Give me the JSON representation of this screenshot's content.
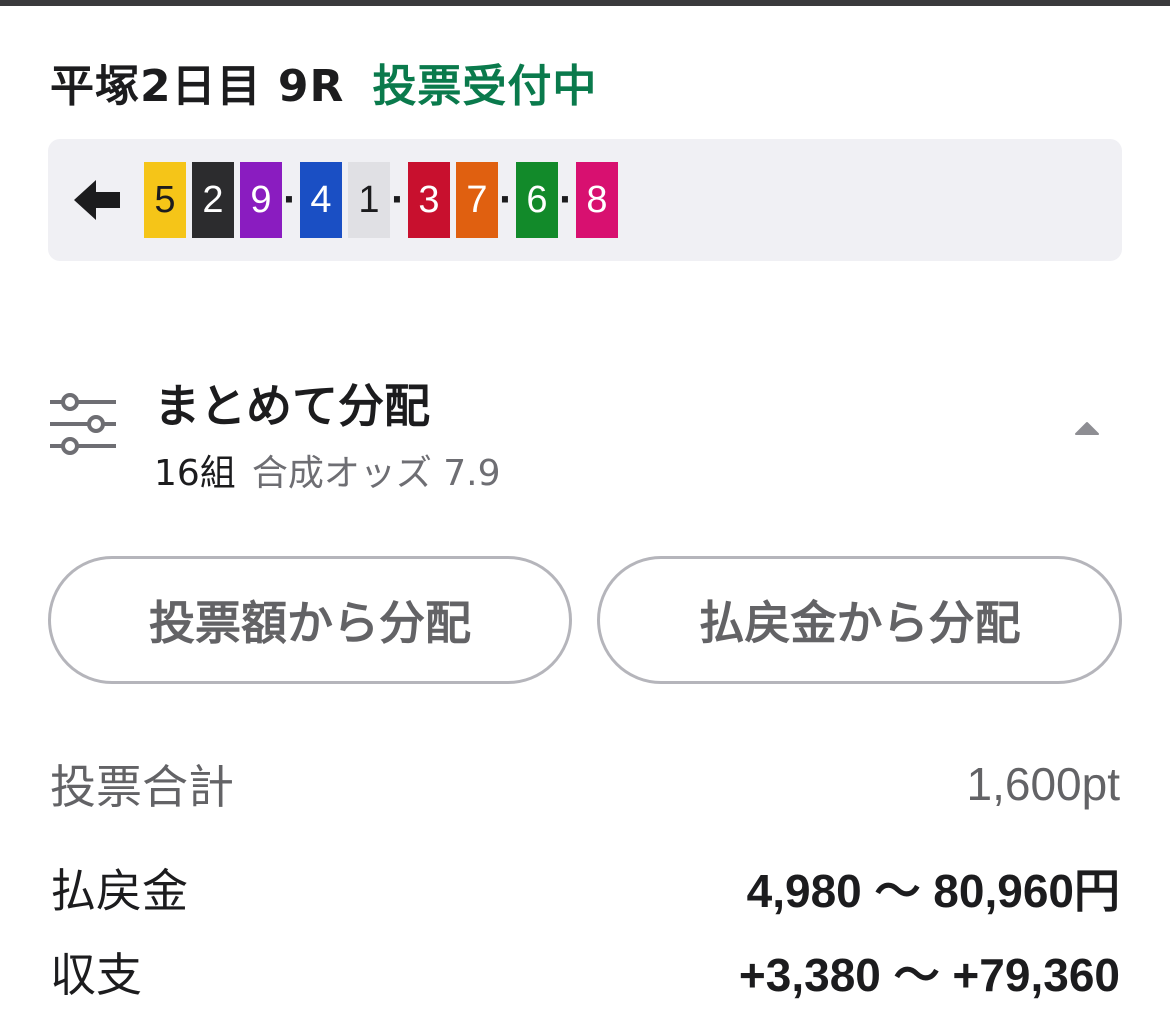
{
  "header": {
    "race_title": "平塚2日目 9R",
    "status": "投票受付中",
    "status_color": "#0a7a4c"
  },
  "line": {
    "direction_icon": "arrow-left-icon",
    "groups": [
      [
        {
          "number": "5",
          "bg": "#f5c518",
          "fg": "#1c1c1e"
        },
        {
          "number": "2",
          "bg": "#2c2c2e",
          "fg": "#ffffff"
        },
        {
          "number": "9",
          "bg": "#8a1cc0",
          "fg": "#ffffff"
        }
      ],
      [
        {
          "number": "4",
          "bg": "#1a4fc4",
          "fg": "#ffffff"
        },
        {
          "number": "1",
          "bg": "#e0e0e4",
          "fg": "#1c1c1e"
        }
      ],
      [
        {
          "number": "3",
          "bg": "#c8102e",
          "fg": "#ffffff"
        },
        {
          "number": "7",
          "bg": "#e06010",
          "fg": "#ffffff"
        }
      ],
      [
        {
          "number": "6",
          "bg": "#128a2a",
          "fg": "#ffffff"
        }
      ],
      [
        {
          "number": "8",
          "bg": "#d81070",
          "fg": "#ffffff"
        }
      ]
    ],
    "separator": "·"
  },
  "distribution": {
    "icon": "sliders-icon",
    "title": "まとめて分配",
    "count": "16組",
    "odds": "合成オッズ 7.9",
    "toggle_icon": "caret-up-icon"
  },
  "buttons": {
    "by_bet_amount": "投票額から分配",
    "by_payout": "払戻金から分配"
  },
  "summary": {
    "total_label": "投票合計",
    "total_value": "1,600pt",
    "payout_label": "払戻金",
    "payout_value": "4,980 〜 80,960円",
    "balance_label": "収支",
    "balance_value": "+3,380 〜 +79,360"
  }
}
